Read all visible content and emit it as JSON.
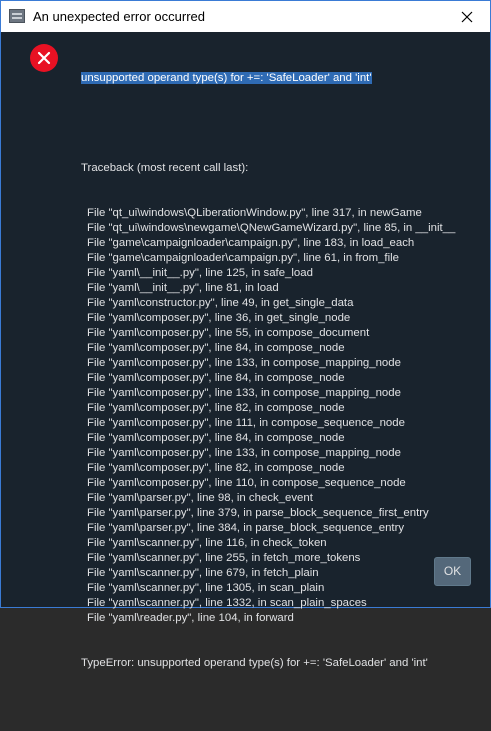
{
  "window": {
    "title": "An unexpected error occurred",
    "app_icon": "app-icon",
    "close_icon": "close-icon"
  },
  "colors": {
    "background": "#19232d",
    "text": "#e0e1e3",
    "selection": "#2f6bb4",
    "error_red": "#e81123",
    "button": "#54687a"
  },
  "message": {
    "icon": "error-icon",
    "headline": "unsupported operand type(s) for +=: 'SafeLoader' and 'int'",
    "traceback_header": "Traceback (most recent call last):",
    "frames": [
      "File \"qt_ui\\windows\\QLiberationWindow.py\", line 317, in newGame",
      "File \"qt_ui\\windows\\newgame\\QNewGameWizard.py\", line 85, in __init__",
      "File \"game\\campaignloader\\campaign.py\", line 183, in load_each",
      "File \"game\\campaignloader\\campaign.py\", line 61, in from_file",
      "File \"yaml\\__init__.py\", line 125, in safe_load",
      "File \"yaml\\__init__.py\", line 81, in load",
      "File \"yaml\\constructor.py\", line 49, in get_single_data",
      "File \"yaml\\composer.py\", line 36, in get_single_node",
      "File \"yaml\\composer.py\", line 55, in compose_document",
      "File \"yaml\\composer.py\", line 84, in compose_node",
      "File \"yaml\\composer.py\", line 133, in compose_mapping_node",
      "File \"yaml\\composer.py\", line 84, in compose_node",
      "File \"yaml\\composer.py\", line 133, in compose_mapping_node",
      "File \"yaml\\composer.py\", line 82, in compose_node",
      "File \"yaml\\composer.py\", line 111, in compose_sequence_node",
      "File \"yaml\\composer.py\", line 84, in compose_node",
      "File \"yaml\\composer.py\", line 133, in compose_mapping_node",
      "File \"yaml\\composer.py\", line 82, in compose_node",
      "File \"yaml\\composer.py\", line 110, in compose_sequence_node",
      "File \"yaml\\parser.py\", line 98, in check_event",
      "File \"yaml\\parser.py\", line 379, in parse_block_sequence_first_entry",
      "File \"yaml\\parser.py\", line 384, in parse_block_sequence_entry",
      "File \"yaml\\scanner.py\", line 116, in check_token",
      "File \"yaml\\scanner.py\", line 255, in fetch_more_tokens",
      "File \"yaml\\scanner.py\", line 679, in fetch_plain",
      "File \"yaml\\scanner.py\", line 1305, in scan_plain",
      "File \"yaml\\scanner.py\", line 1332, in scan_plain_spaces",
      "File \"yaml\\reader.py\", line 104, in forward"
    ],
    "error_line": "TypeError: unsupported operand type(s) for +=: 'SafeLoader' and 'int'"
  },
  "buttons": {
    "ok_label": "OK"
  }
}
